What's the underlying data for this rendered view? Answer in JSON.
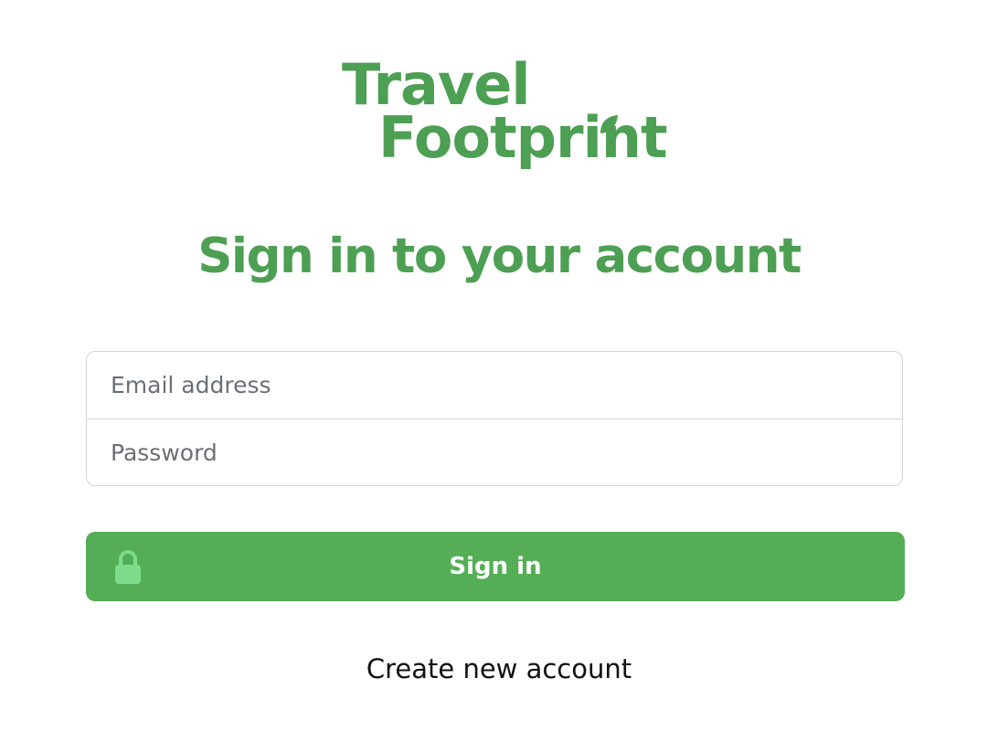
{
  "logo": {
    "line1": "Travel",
    "line2": "Footprint",
    "alt": "Travel Footprint logo"
  },
  "heading": "Sign in to your account",
  "form": {
    "email_placeholder": "Email address",
    "email_value": "",
    "password_placeholder": "Password",
    "password_value": ""
  },
  "signin_button": {
    "label": "Sign in",
    "icon": "lock-icon"
  },
  "create_account_link": "Create new account",
  "colors": {
    "brand_green": "#4d9f53",
    "button_green": "#55ae56",
    "lock_green": "#7cdc8c",
    "border_gray": "#d4d4d8",
    "placeholder_gray": "#6b6f76"
  }
}
